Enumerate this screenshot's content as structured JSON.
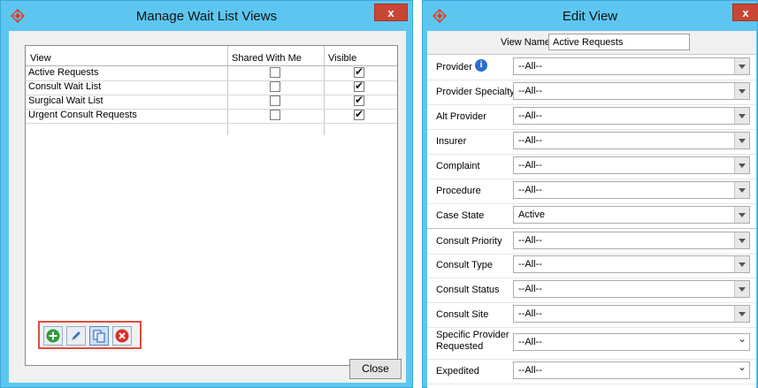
{
  "left_window": {
    "title": "Manage Wait List Views",
    "close_glyph": "x",
    "columns": {
      "view": "View",
      "shared": "Shared With Me",
      "visible": "Visible"
    },
    "rows": [
      {
        "name": "Active Requests",
        "shared": false,
        "visible": true
      },
      {
        "name": "Consult Wait List",
        "shared": false,
        "visible": true
      },
      {
        "name": "Surgical Wait List",
        "shared": false,
        "visible": true
      },
      {
        "name": "Urgent Consult Requests",
        "shared": false,
        "visible": true
      }
    ],
    "toolbar": {
      "buttons": [
        {
          "icon": "add-icon",
          "color": "#2e9b3a"
        },
        {
          "icon": "edit-pencil-icon",
          "color": "#3b73c4"
        },
        {
          "icon": "copy-icon",
          "color": "#3b73c4"
        },
        {
          "icon": "delete-icon",
          "color": "#d8312a"
        }
      ]
    },
    "close_button": "Close"
  },
  "right_window": {
    "title": "Edit View",
    "close_glyph": "x",
    "view_name_label": "View Name",
    "view_name_value": "Active Requests",
    "fields": [
      {
        "label": "Provider",
        "value": "--All--",
        "info": true
      },
      {
        "label": "Provider Specialty",
        "value": "--All--"
      },
      {
        "label": "Alt Provider",
        "value": "--All--"
      },
      {
        "label": "Insurer",
        "value": "--All--"
      },
      {
        "label": "Complaint",
        "value": "--All--"
      },
      {
        "label": "Procedure",
        "value": "--All--"
      },
      {
        "label": "Case State",
        "value": "Active"
      },
      {
        "label": "Consult Priority",
        "value": "--All--"
      },
      {
        "label": "Consult Type",
        "value": "--All--"
      },
      {
        "label": "Consult Status",
        "value": "--All--"
      },
      {
        "label": "Consult Site",
        "value": "--All--"
      },
      {
        "label": "Specific Provider Requested",
        "value": "--All--"
      },
      {
        "label": "Expedited",
        "value": "--All--"
      }
    ]
  },
  "colors": {
    "window_frame": "#5dc6f0",
    "close_button": "#c94535",
    "toolbar_highlight": "#e04c3a"
  }
}
